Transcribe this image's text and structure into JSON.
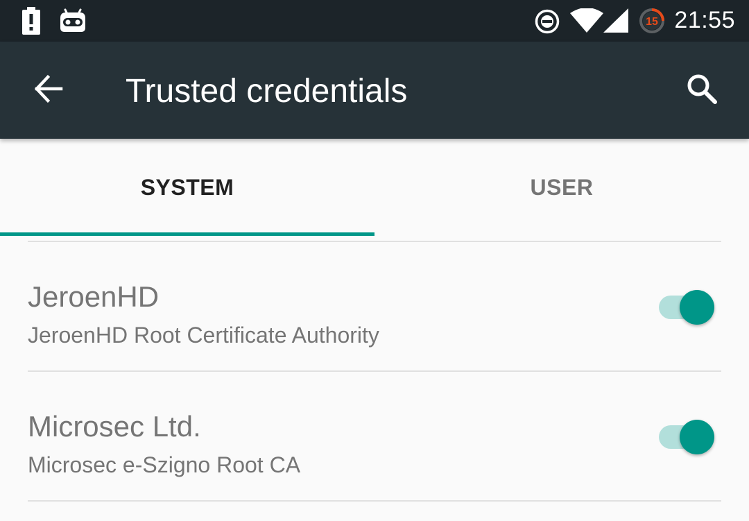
{
  "status_bar": {
    "time": "21:55",
    "notification_badge": "15",
    "icons": [
      "battery-alert-icon",
      "cyanogenmod-icon",
      "do-not-disturb-icon",
      "wifi-icon",
      "cell-signal-icon",
      "timer-notification-icon"
    ]
  },
  "toolbar": {
    "title": "Trusted credentials",
    "back_icon": "arrow-back-icon",
    "search_icon": "search-icon"
  },
  "tabs": [
    {
      "label": "SYSTEM",
      "selected": true
    },
    {
      "label": "USER",
      "selected": false
    }
  ],
  "credentials": [
    {
      "title": "JeroenHD",
      "subtitle": "JeroenHD Root Certificate Authority",
      "enabled": true
    },
    {
      "title": "Microsec Ltd.",
      "subtitle": "Microsec e-Szigno Root CA",
      "enabled": true
    }
  ],
  "colors": {
    "status_bar": "#1c2429",
    "toolbar": "#263238",
    "accent": "#009688",
    "switch_track": "#b2dfdb",
    "background": "#fafafa",
    "badge_ring": "#e64a19"
  }
}
